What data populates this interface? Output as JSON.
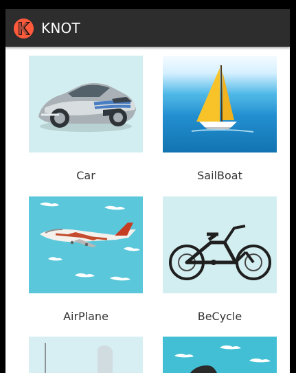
{
  "app": {
    "title": "KNOT"
  },
  "grid": {
    "items": [
      {
        "label": "Car"
      },
      {
        "label": "SailBoat"
      },
      {
        "label": "AirPlane"
      },
      {
        "label": "BeCycle"
      },
      {
        "label": ""
      },
      {
        "label": ""
      }
    ]
  },
  "colors": {
    "action_bar": "#2d2d2d",
    "logo": "#e8362f",
    "tile_pale": "#d3eef0",
    "tile_teal": "#5bc7da"
  },
  "icons": {
    "logo": "knot-logo-icon"
  }
}
